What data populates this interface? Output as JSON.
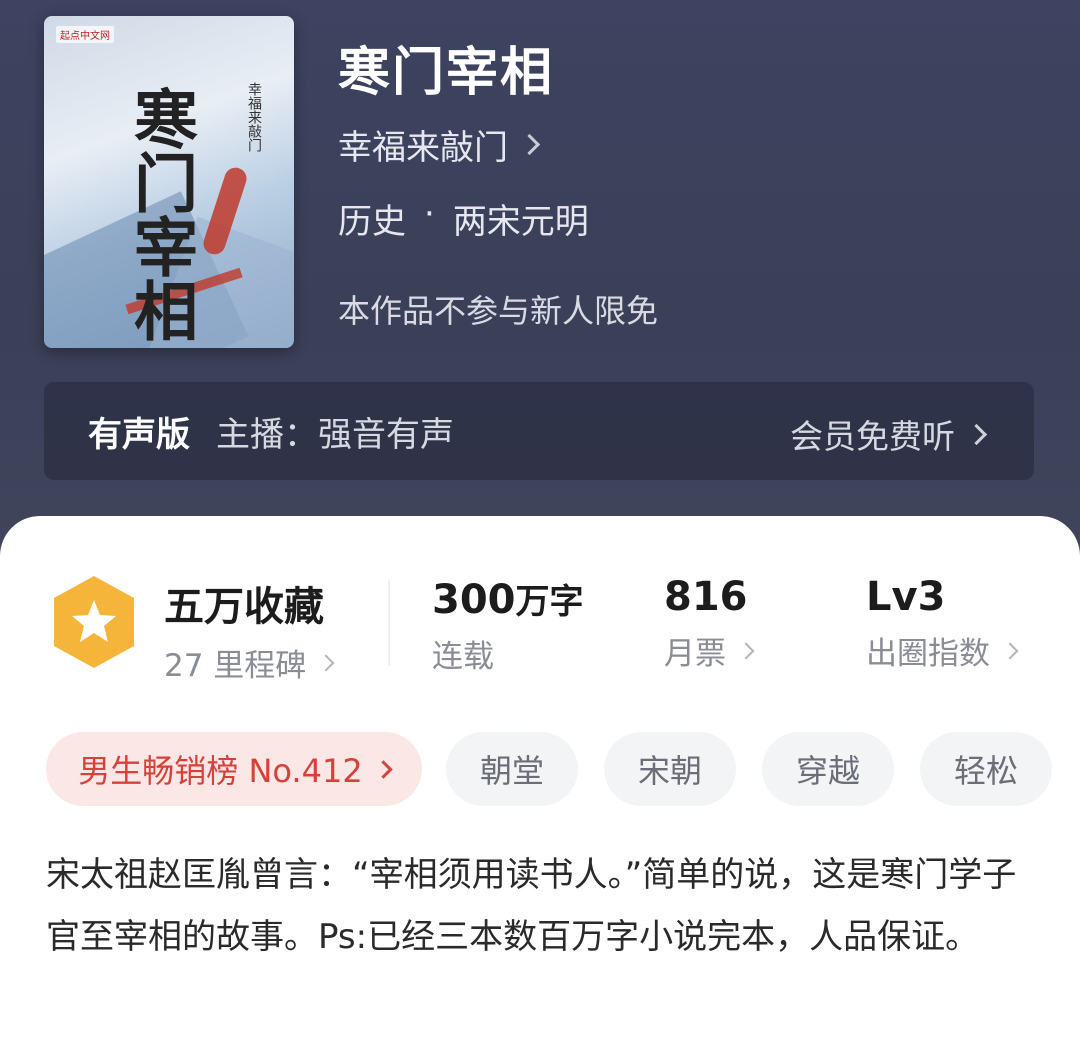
{
  "book": {
    "title": "寒门宰相",
    "author": "幸福来敲门",
    "genre": "历史",
    "genre_sep": "·",
    "subgenre": "两宋元明",
    "note": "本作品不参与新人限免",
    "cover": {
      "publisher_mark": "起点中文网",
      "title_text": "寒门宰相",
      "author_text": "幸福来敲门"
    }
  },
  "audio": {
    "tag": "有声版",
    "anchor": "主播：强音有声",
    "free_listen": "会员免费听"
  },
  "stats": {
    "favorites": "五万收藏",
    "milestones": "27 里程碑",
    "words_num": "300",
    "words_unit": "万字",
    "words_status": "连载",
    "monthly_votes": "816",
    "monthly_votes_label": "月票",
    "level": "Lv3",
    "level_label": "出圈指数"
  },
  "tags": {
    "rank": "男生畅销榜 No.412",
    "items": [
      "朝堂",
      "宋朝",
      "穿越",
      "轻松"
    ]
  },
  "description": "宋太祖赵匡胤曾言：“宰相须用读书人。”简单的说，这是寒门学子官至宰相的故事。Ps:已经三本数百万字小说完本，人品保证。",
  "colors": {
    "hero_bg": "#3d4360",
    "badge_orange": "#f4b53a",
    "rank_red": "#d6413a"
  },
  "icons": {
    "badge": "star-hexagon-icon",
    "chevron": "chevron-right-icon"
  }
}
